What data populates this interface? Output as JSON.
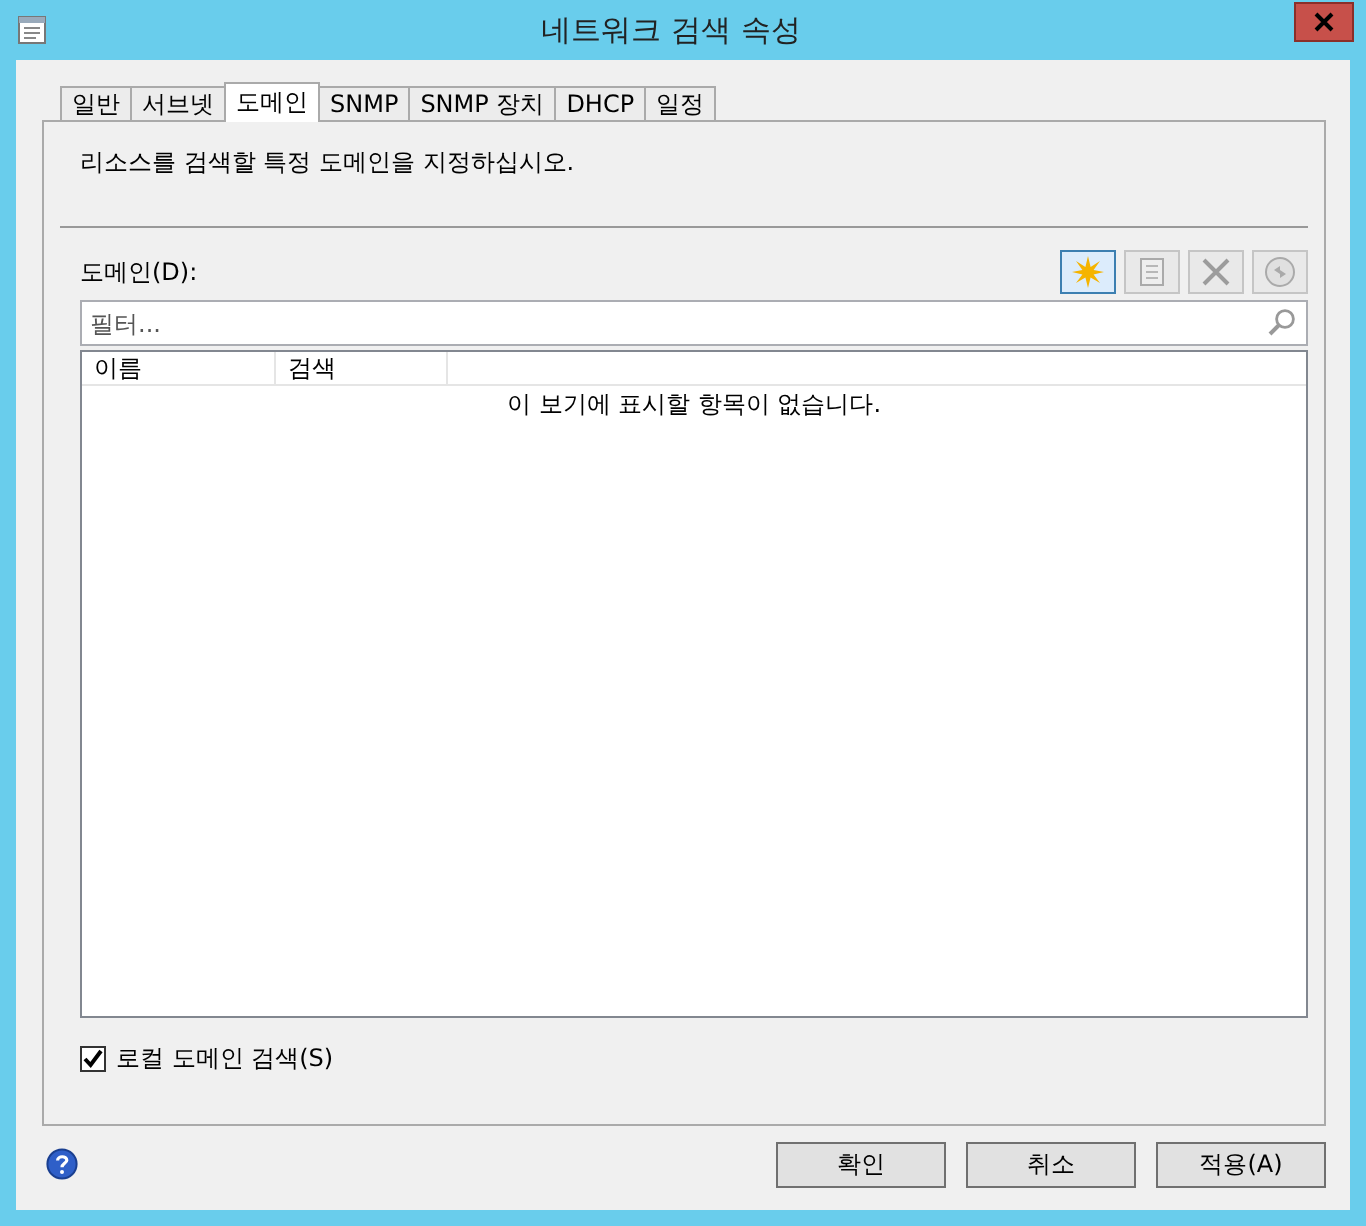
{
  "window": {
    "title": "네트워크 검색 속성"
  },
  "tabs": [
    {
      "label": "일반",
      "selected": false
    },
    {
      "label": "서브넷",
      "selected": false
    },
    {
      "label": "도메인",
      "selected": true
    },
    {
      "label": "SNMP",
      "selected": false
    },
    {
      "label": "SNMP 장치",
      "selected": false
    },
    {
      "label": "DHCP",
      "selected": false
    },
    {
      "label": "일정",
      "selected": false
    }
  ],
  "description": "리소스를 검색할 특정 도메인을 지정하십시오.",
  "domains_label": "도메인(D):",
  "toolbar": [
    {
      "kind": "new",
      "disabled": false
    },
    {
      "kind": "properties",
      "disabled": true
    },
    {
      "kind": "delete",
      "disabled": true
    },
    {
      "kind": "refresh",
      "disabled": true
    }
  ],
  "search": {
    "placeholder": "필터..."
  },
  "table": {
    "columns": [
      "이름",
      "검색"
    ],
    "empty_message": "이 보기에 표시할 항목이 없습니다."
  },
  "local_domain": {
    "label": "로컬 도메인 검색(S)",
    "checked": true
  },
  "buttons": [
    "확인",
    "취소",
    "적용(A)"
  ]
}
